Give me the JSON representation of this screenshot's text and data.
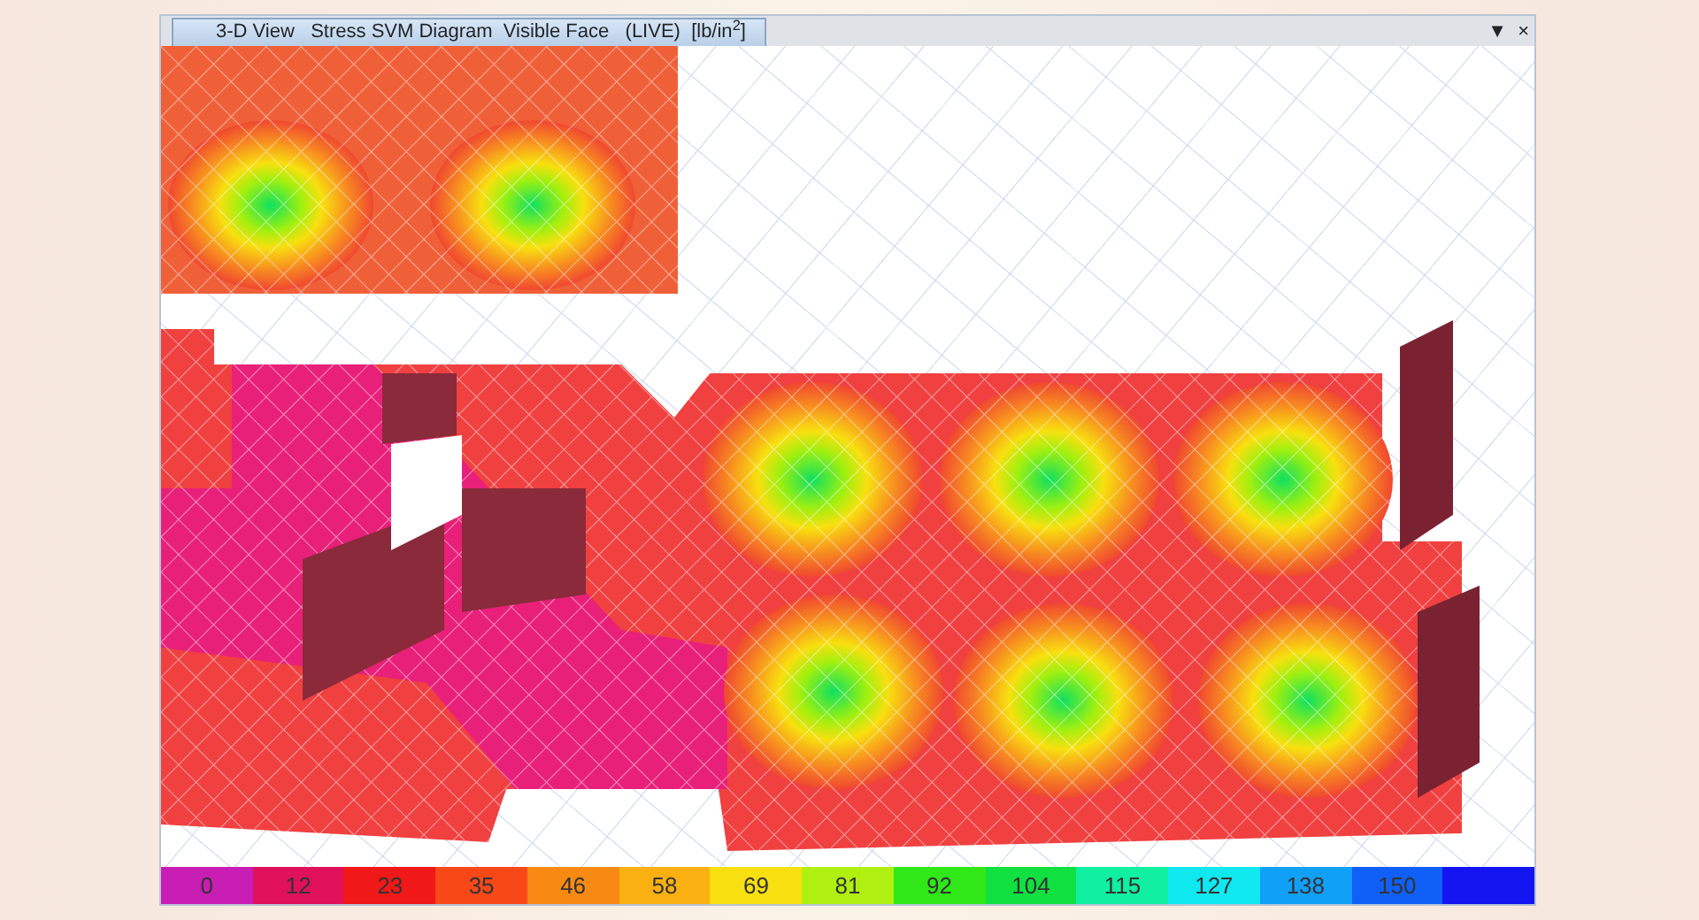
{
  "window": {
    "tab_title": "3-D View   Stress SVM Diagram  Visible Face   (LIVE)  [lb/in$^{2}$]",
    "dropdown_glyph": "▼",
    "close_glyph": "×"
  },
  "legend": [
    {
      "label": "0",
      "color": "#c81eb4"
    },
    {
      "label": "12",
      "color": "#e0105a"
    },
    {
      "label": "23",
      "color": "#f01818"
    },
    {
      "label": "35",
      "color": "#f84818"
    },
    {
      "label": "46",
      "color": "#f88a14"
    },
    {
      "label": "58",
      "color": "#fab010"
    },
    {
      "label": "69",
      "color": "#f8e010"
    },
    {
      "label": "81",
      "color": "#b0f010"
    },
    {
      "label": "92",
      "color": "#30e818"
    },
    {
      "label": "104",
      "color": "#10e040"
    },
    {
      "label": "115",
      "color": "#10f0a0"
    },
    {
      "label": "127",
      "color": "#10e8f0"
    },
    {
      "label": "138",
      "color": "#10a0f8"
    },
    {
      "label": "150",
      "color": "#1060f8"
    },
    {
      "color": "#1414f0"
    }
  ]
}
